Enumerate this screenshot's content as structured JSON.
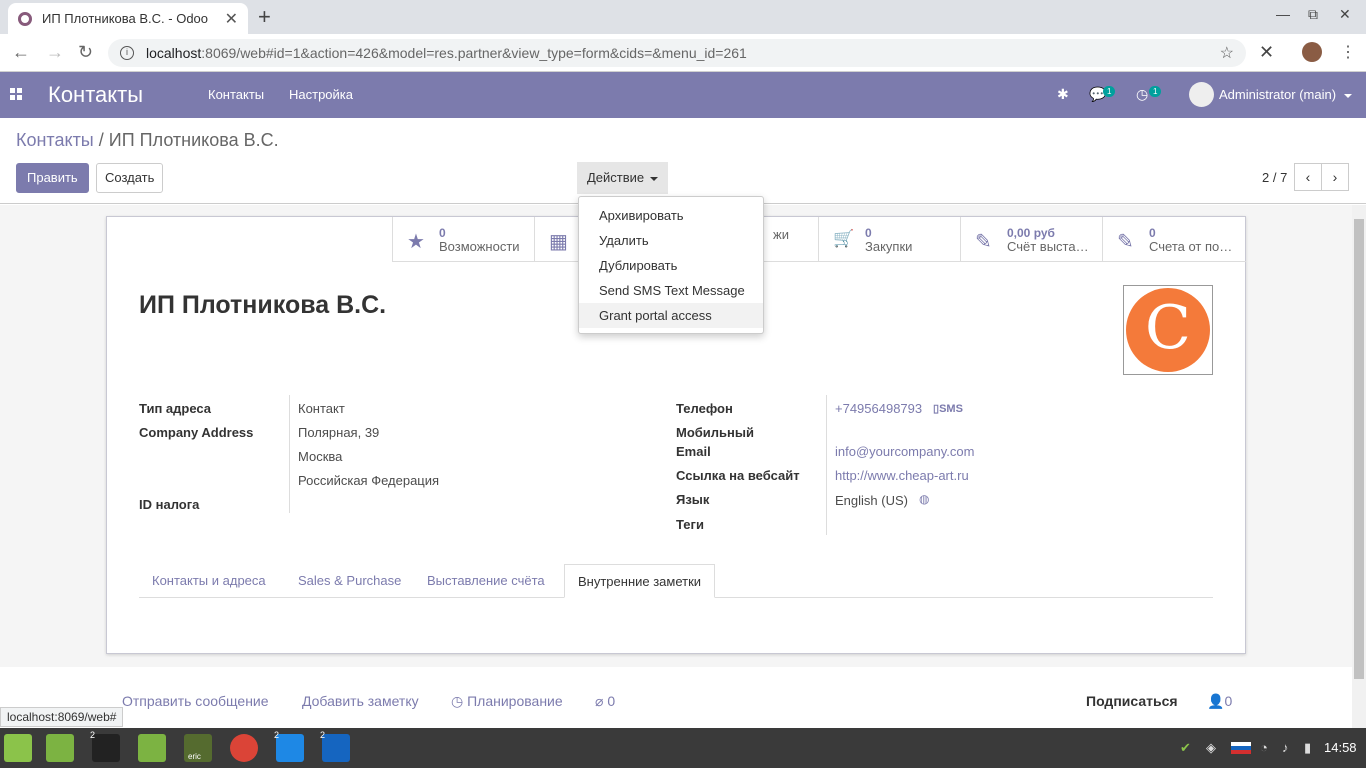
{
  "browser": {
    "tab_title": "ИП Плотникова В.С. - Odoo",
    "url_host": "localhost",
    "url_rest": ":8069/web#id=1&action=426&model=res.partner&view_type=form&cids=&menu_id=261",
    "status_url": "localhost:8069/web#"
  },
  "navbar": {
    "app_name": "Контакты",
    "menu": [
      "Контакты",
      "Настройка"
    ],
    "messages_count": "1",
    "activities_count": "1",
    "user": "Administrator (main)"
  },
  "control_panel": {
    "breadcrumb_parent": "Контакты",
    "breadcrumb_sep": "/",
    "breadcrumb_current": "ИП Плотникова В.С.",
    "edit_label": "Править",
    "create_label": "Создать",
    "action_label": "Действие",
    "pager": "2 / 7"
  },
  "action_menu": [
    "Архивировать",
    "Удалить",
    "Дублировать",
    "Send SMS Text Message",
    "Grant portal access"
  ],
  "smart_buttons": [
    {
      "icon": "star-icon",
      "glyph": "★",
      "value": "0",
      "label": "Возможности"
    },
    {
      "icon": "calendar-icon",
      "glyph": "▦",
      "value": "",
      "label": ""
    },
    {
      "icon": "dollar-icon",
      "glyph": "$",
      "value": "",
      "label": "жи"
    },
    {
      "icon": "cart-icon",
      "glyph": "🛒",
      "value": "0",
      "label": "Закупки"
    },
    {
      "icon": "edit-icon",
      "glyph": "✎",
      "value": "0,00 руб",
      "label": "Счёт выста…"
    },
    {
      "icon": "edit-icon",
      "glyph": "✎",
      "value": "0",
      "label": "Счета от по…"
    }
  ],
  "partner": {
    "name": "ИП Плотникова В.С.",
    "logo_letter": "C"
  },
  "fields_left": {
    "address_type_label": "Тип адреса",
    "address_type_value": "Контакт",
    "company_address_label": "Company Address",
    "street": "Полярная, 39",
    "city": "Москва",
    "country": "Российская Федерация",
    "tax_id_label": "ID налога"
  },
  "fields_right": {
    "phone_label": "Телефон",
    "phone_value": "+74956498793",
    "sms_label": "SMS",
    "mobile_label": "Мобильный",
    "email_label": "Email",
    "email_value": "info@yourcompany.com",
    "website_label": "Ссылка на вебсайт",
    "website_value": "http://www.cheap-art.ru",
    "language_label": "Язык",
    "language_value": "English (US)",
    "tags_label": "Теги"
  },
  "form_tabs": [
    "Контакты и адреса",
    "Sales & Purchase",
    "Выставление счёта",
    "Внутренние заметки"
  ],
  "chatter": {
    "send_message": "Отправить сообщение",
    "log_note": "Добавить заметку",
    "schedule": "Планирование",
    "attachments": "0",
    "follow": "Подписаться",
    "followers": "0"
  },
  "taskbar": {
    "clock": "14:58",
    "badges": [
      "2",
      "2",
      "2"
    ],
    "eric_label": "eric"
  }
}
